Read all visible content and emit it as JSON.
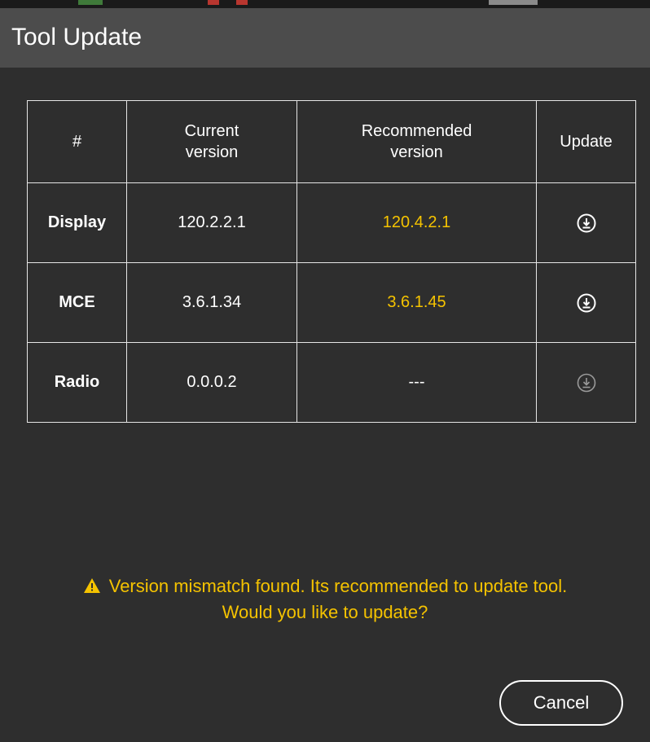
{
  "dialog": {
    "title": "Tool Update"
  },
  "table": {
    "headers": {
      "index": "#",
      "current_line1": "Current",
      "current_line2": "version",
      "recommended_line1": "Recommended",
      "recommended_line2": "version",
      "update": "Update"
    },
    "rows": [
      {
        "name": "Display",
        "current": "120.2.2.1",
        "recommended": "120.4.2.1",
        "update_icon": "download-icon",
        "update_enabled": true
      },
      {
        "name": "MCE",
        "current": "3.6.1.34",
        "recommended": "3.6.1.45",
        "update_icon": "download-icon",
        "update_enabled": true
      },
      {
        "name": "Radio",
        "current": "0.0.0.2",
        "recommended": "---",
        "update_icon": "download-icon",
        "update_enabled": false
      }
    ]
  },
  "warning": {
    "icon": "warning-triangle-icon",
    "line1": "Version mismatch found. Its recommended to update tool.",
    "line2": "Would you like to update?"
  },
  "buttons": {
    "cancel_label": "Cancel"
  },
  "colors": {
    "background": "#2e2e2e",
    "titlebar": "#4c4c4c",
    "accent": "#f5c300",
    "border": "#e6e6e6",
    "disabled_icon": "#9a9a9a"
  }
}
